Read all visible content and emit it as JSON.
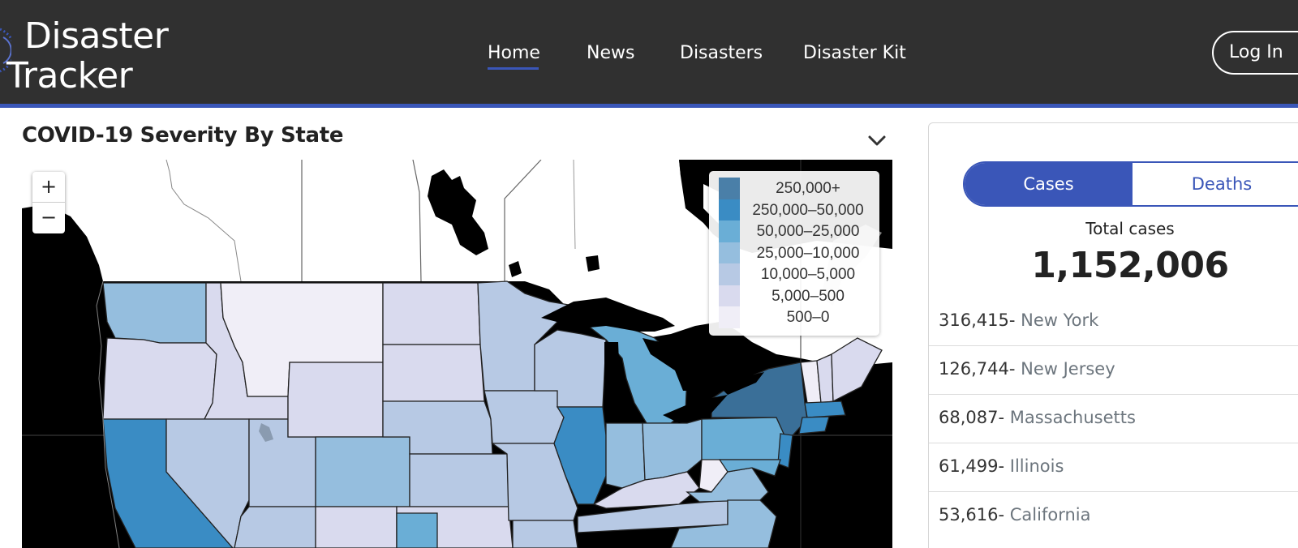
{
  "header": {
    "logo_line1": "Disaster",
    "logo_line2": "Tracker",
    "nav": [
      {
        "label": "Home",
        "active": true
      },
      {
        "label": "News",
        "active": false
      },
      {
        "label": "Disasters",
        "active": false
      },
      {
        "label": "Disaster Kit",
        "active": false
      }
    ],
    "login_label": "Log In",
    "accent_color": "#3a56b8",
    "background_color": "#303030"
  },
  "map_panel": {
    "title": "COVID-19 Severity By State",
    "zoom_in": "+",
    "zoom_out": "−",
    "legend": [
      {
        "label": "250,000+",
        "color": "#4a7fa8"
      },
      {
        "label": "250,000–50,000",
        "color": "#3a8cc4"
      },
      {
        "label": "50,000–25,000",
        "color": "#6aaed6"
      },
      {
        "label": "25,000–10,000",
        "color": "#95bede"
      },
      {
        "label": "10,000–5,000",
        "color": "#b7c9e4"
      },
      {
        "label": "5,000–500",
        "color": "#d9daee"
      },
      {
        "label": "500–0",
        "color": "#f0eef7"
      }
    ]
  },
  "stats_panel": {
    "tab_cases": "Cases",
    "tab_deaths": "Deaths",
    "total_label": "Total cases",
    "total_value": "1,152,006",
    "states": [
      {
        "count": "316,415",
        "separator": "- ",
        "name": "New York"
      },
      {
        "count": "126,744",
        "separator": "- ",
        "name": "New Jersey"
      },
      {
        "count": "68,087",
        "separator": "- ",
        "name": "Massachusetts"
      },
      {
        "count": "61,499",
        "separator": "- ",
        "name": "Illinois"
      },
      {
        "count": "53,616",
        "separator": "- ",
        "name": "California"
      }
    ]
  }
}
